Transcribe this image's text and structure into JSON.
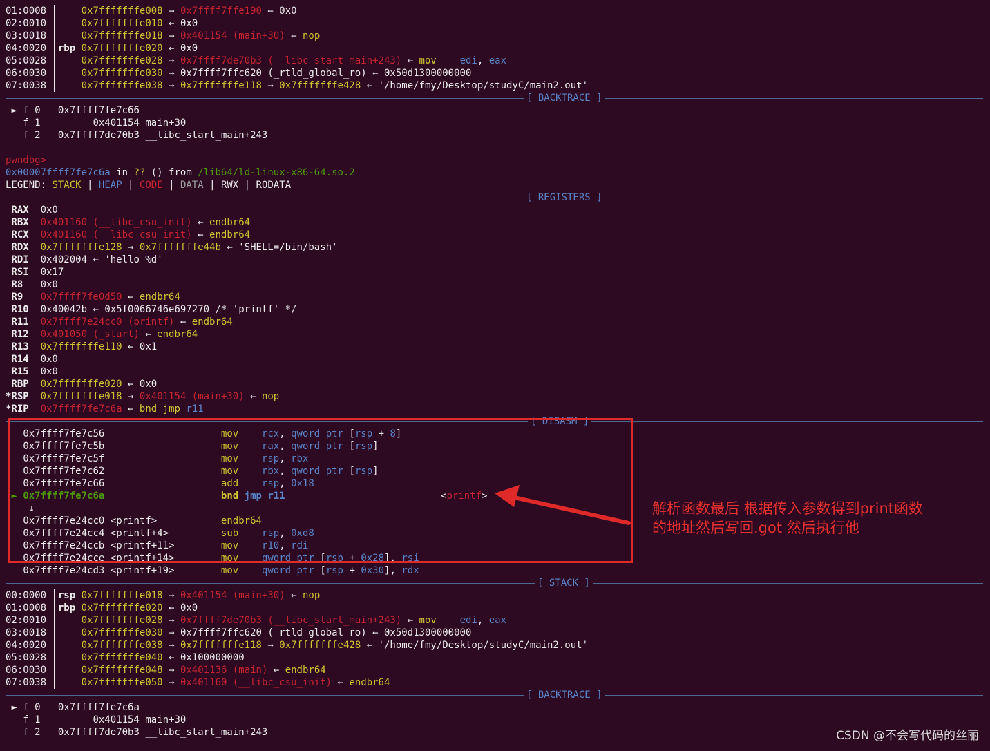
{
  "stack1": [
    {
      "idx": "01:0008",
      "reg": "   ",
      "addr": "0x7fffffffe008",
      "a1": "→",
      "p1": "0x7ffff7ffe190",
      "a2": "←",
      "p2": "0x0"
    },
    {
      "idx": "02:0010",
      "reg": "   ",
      "addr": "0x7fffffffe010",
      "a1": "←",
      "p1": "0x0",
      "a2": "",
      "p2": ""
    },
    {
      "idx": "03:0018",
      "reg": "   ",
      "addr": "0x7fffffffe018",
      "a1": "→",
      "p1": "0x401154 (main+30)",
      "a2": "←",
      "p2": "nop"
    },
    {
      "idx": "04:0020",
      "reg": "rbp",
      "addr": "0x7fffffffe020",
      "a1": "←",
      "p1": "0x0",
      "a2": "",
      "p2": ""
    },
    {
      "idx": "05:0028",
      "reg": "   ",
      "addr": "0x7fffffffe028",
      "a1": "→",
      "p1": "0x7ffff7de70b3 (__libc_start_main+243)",
      "a2": "←",
      "p2": "mov    edi, eax"
    },
    {
      "idx": "06:0030",
      "reg": "   ",
      "addr": "0x7fffffffe030",
      "a1": "→",
      "p1": "0x7ffff7ffc620 (_rtld_global_ro)",
      "a2": "←",
      "p2": "0x50d1300000000"
    },
    {
      "idx": "07:0038",
      "reg": "   ",
      "addr": "0x7fffffffe038",
      "a1": "→",
      "p1": "0x7fffffffe118",
      "a2": "→",
      "p2": "0x7fffffffe428 ← '/home/fmy/Desktop/studyC/main2.out'"
    }
  ],
  "backtrace_label": "[ BACKTRACE ]",
  "backtrace1": [
    {
      "marker": "►",
      "frame": "f 0",
      "addr": "0x7ffff7fe7c66",
      "sym": ""
    },
    {
      "marker": " ",
      "frame": "f 1",
      "addr": "      0x401154",
      "sym": "main+30"
    },
    {
      "marker": " ",
      "frame": "f 2",
      "addr": "0x7ffff7de70b3",
      "sym": "__libc_start_main+243"
    }
  ],
  "prompt": "pwndbg>",
  "location": {
    "addr": "0x00007ffff7fe7c6a",
    "in": "in",
    "q": "??",
    "paren": "()",
    "from": "from",
    "lib": "/lib64/ld-linux-x86-64.so.2"
  },
  "legend": {
    "label": "LEGEND:",
    "stack": "STACK",
    "heap": "HEAP",
    "code": "CODE",
    "data": "DATA",
    "rwx": "RWX",
    "rodata": "RODATA"
  },
  "registers_label": "[ REGISTERS ]",
  "registers": [
    {
      "name": " RAX",
      "val": "0x0",
      "kind": "w",
      "rest": ""
    },
    {
      "name": " RBX",
      "val": "0x401160 (__libc_csu_init)",
      "kind": "r",
      "rest": "← endbr64"
    },
    {
      "name": " RCX",
      "val": "0x401160 (__libc_csu_init)",
      "kind": "r",
      "rest": "← endbr64"
    },
    {
      "name": " RDX",
      "val": "0x7fffffffe128",
      "kind": "y",
      "rest": "→ 0x7fffffffe44b ← 'SHELL=/bin/bash'"
    },
    {
      "name": " RDI",
      "val": "0x402004",
      "kind": "w",
      "rest": "← 'hello %d'"
    },
    {
      "name": " RSI",
      "val": "0x17",
      "kind": "w",
      "rest": ""
    },
    {
      "name": " R8 ",
      "val": "0x0",
      "kind": "w",
      "rest": ""
    },
    {
      "name": " R9 ",
      "val": "0x7ffff7fe0d50",
      "kind": "r",
      "rest": "← endbr64"
    },
    {
      "name": " R10",
      "val": "0x40042b",
      "kind": "w",
      "rest": "← 0x5f0066746e697270 /* 'printf' */"
    },
    {
      "name": " R11",
      "val": "0x7ffff7e24cc0 (printf)",
      "kind": "r",
      "rest": "← endbr64"
    },
    {
      "name": " R12",
      "val": "0x401050 (_start)",
      "kind": "r",
      "rest": "← endbr64"
    },
    {
      "name": " R13",
      "val": "0x7fffffffe110",
      "kind": "y",
      "rest": "← 0x1"
    },
    {
      "name": " R14",
      "val": "0x0",
      "kind": "w",
      "rest": ""
    },
    {
      "name": " R15",
      "val": "0x0",
      "kind": "w",
      "rest": ""
    },
    {
      "name": " RBP",
      "val": "0x7fffffffe020",
      "kind": "y",
      "rest": "← 0x0"
    },
    {
      "name": "*RSP",
      "val": "0x7fffffffe018",
      "kind": "y",
      "rest": "→ 0x401154 (main+30) ← nop"
    },
    {
      "name": "*RIP",
      "val": "0x7ffff7fe7c6a",
      "kind": "r",
      "rest": "← bnd jmp r11"
    }
  ],
  "disasm_label": "[ DISASM ]",
  "disasm": [
    {
      "marker": " ",
      "addr": "0x7ffff7fe7c56",
      "sym": "",
      "mn": "mov",
      "ops": "rcx, qword ptr [rsp + 8]",
      "note": ""
    },
    {
      "marker": " ",
      "addr": "0x7ffff7fe7c5b",
      "sym": "",
      "mn": "mov",
      "ops": "rax, qword ptr [rsp]",
      "note": ""
    },
    {
      "marker": " ",
      "addr": "0x7ffff7fe7c5f",
      "sym": "",
      "mn": "mov",
      "ops": "rsp, rbx",
      "note": ""
    },
    {
      "marker": " ",
      "addr": "0x7ffff7fe7c62",
      "sym": "",
      "mn": "mov",
      "ops": "rbx, qword ptr [rsp]",
      "note": ""
    },
    {
      "marker": " ",
      "addr": "0x7ffff7fe7c66",
      "sym": "",
      "mn": "add",
      "ops": "rsp, 0x18",
      "note": ""
    },
    {
      "marker": "►",
      "addr": "0x7ffff7fe7c6a",
      "sym": "",
      "mn": "bnd jmp r11",
      "ops": "",
      "note": "<printf>"
    },
    {
      "marker": " ",
      "addr": "↓",
      "sym": "",
      "mn": "",
      "ops": "",
      "note": ""
    },
    {
      "marker": " ",
      "addr": "0x7ffff7e24cc0",
      "sym": "<printf>",
      "mn": "endbr64",
      "ops": "",
      "note": ""
    },
    {
      "marker": " ",
      "addr": "0x7ffff7e24cc4",
      "sym": "<printf+4>",
      "mn": "sub",
      "ops": "rsp, 0xd8",
      "note": ""
    },
    {
      "marker": " ",
      "addr": "0x7ffff7e24ccb",
      "sym": "<printf+11>",
      "mn": "mov",
      "ops": "r10, rdi",
      "note": ""
    },
    {
      "marker": " ",
      "addr": "0x7ffff7e24cce",
      "sym": "<printf+14>",
      "mn": "mov",
      "ops": "qword ptr [rsp + 0x28], rsi",
      "note": ""
    },
    {
      "marker": " ",
      "addr": "0x7ffff7e24cd3",
      "sym": "<printf+19>",
      "mn": "mov",
      "ops": "qword ptr [rsp + 0x30], rdx",
      "note": ""
    }
  ],
  "stack_label": "[ STACK ]",
  "stack2": [
    {
      "idx": "00:0000",
      "reg": "rsp",
      "addr": "0x7fffffffe018",
      "a1": "→",
      "p1": "0x401154 (main+30)",
      "a2": "←",
      "p2": "nop"
    },
    {
      "idx": "01:0008",
      "reg": "rbp",
      "addr": "0x7fffffffe020",
      "a1": "←",
      "p1": "0x0",
      "a2": "",
      "p2": ""
    },
    {
      "idx": "02:0010",
      "reg": "   ",
      "addr": "0x7fffffffe028",
      "a1": "→",
      "p1": "0x7ffff7de70b3 (__libc_start_main+243)",
      "a2": "←",
      "p2": "mov    edi, eax"
    },
    {
      "idx": "03:0018",
      "reg": "   ",
      "addr": "0x7fffffffe030",
      "a1": "→",
      "p1": "0x7ffff7ffc620 (_rtld_global_ro)",
      "a2": "←",
      "p2": "0x50d1300000000"
    },
    {
      "idx": "04:0020",
      "reg": "   ",
      "addr": "0x7fffffffe038",
      "a1": "→",
      "p1": "0x7fffffffe118",
      "a2": "→",
      "p2": "0x7fffffffe428 ← '/home/fmy/Desktop/studyC/main2.out'"
    },
    {
      "idx": "05:0028",
      "reg": "   ",
      "addr": "0x7fffffffe040",
      "a1": "←",
      "p1": "0x100000000",
      "a2": "",
      "p2": ""
    },
    {
      "idx": "06:0030",
      "reg": "   ",
      "addr": "0x7fffffffe048",
      "a1": "→",
      "p1": "0x401136 (main)",
      "a2": "←",
      "p2": "endbr64"
    },
    {
      "idx": "07:0038",
      "reg": "   ",
      "addr": "0x7fffffffe050",
      "a1": "→",
      "p1": "0x401160 (__libc_csu_init)",
      "a2": "←",
      "p2": "endbr64"
    }
  ],
  "backtrace2": [
    {
      "marker": "►",
      "frame": "f 0",
      "addr": "0x7ffff7fe7c6a",
      "sym": ""
    },
    {
      "marker": " ",
      "frame": "f 1",
      "addr": "      0x401154",
      "sym": "main+30"
    },
    {
      "marker": " ",
      "frame": "f 2",
      "addr": "0x7ffff7de70b3",
      "sym": "__libc_start_main+243"
    }
  ],
  "annotation": {
    "line1": "解析函数最后 根据传入参数得到print函数",
    "line2": "的地址然后写回.got 然后执行他"
  },
  "watermark": "CSDN @不会写代码的丝丽",
  "colors": {
    "background": "#2d0922",
    "accent_red": "#e02a2a",
    "yellow": "#d0c430",
    "blue": "#5a84c9"
  }
}
